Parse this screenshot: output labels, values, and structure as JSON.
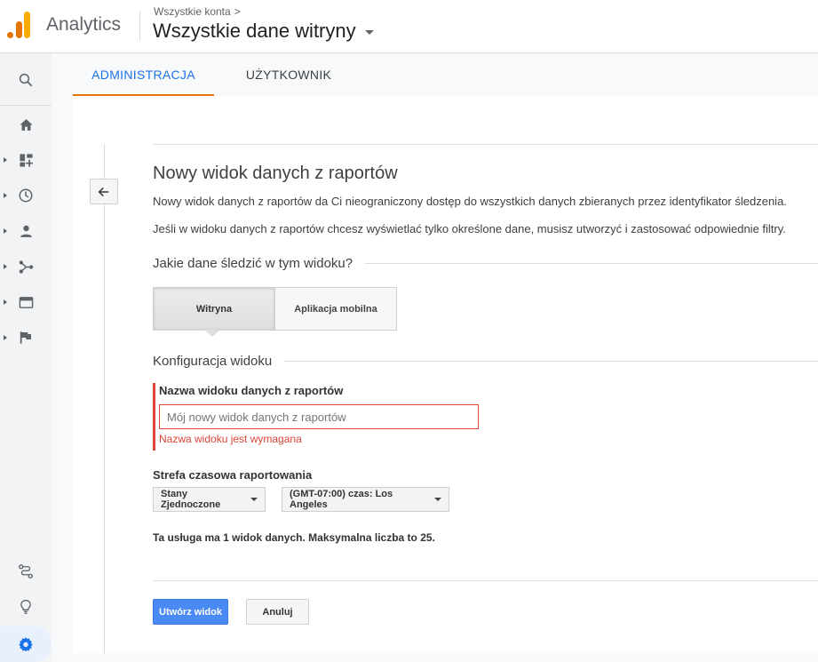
{
  "header": {
    "app_name": "Analytics",
    "breadcrumb": "Wszystkie konta",
    "breadcrumb_chevron": ">",
    "property_name": "Wszystkie dane witryny"
  },
  "sidebar": {
    "items": [
      {
        "icon": "search-icon"
      },
      {
        "icon": "home-icon"
      },
      {
        "icon": "customization-icon"
      },
      {
        "icon": "realtime-clock-icon"
      },
      {
        "icon": "audience-person-icon"
      },
      {
        "icon": "acquisition-icon"
      },
      {
        "icon": "behavior-icon"
      },
      {
        "icon": "conversions-flag-icon"
      },
      {
        "icon": "attribution-icon"
      },
      {
        "icon": "discover-lightbulb-icon"
      },
      {
        "icon": "admin-gear-icon"
      }
    ]
  },
  "tabs": [
    {
      "label": "ADMINISTRACJA",
      "active": true
    },
    {
      "label": "UŻYTKOWNIK",
      "active": false
    }
  ],
  "form": {
    "title": "Nowy widok danych z raportów",
    "desc1": "Nowy widok danych z raportów da Ci nieograniczony dostęp do wszystkich danych zbieranych przez identyfikator śledzenia.",
    "desc2": "Jeśli w widoku danych z raportów chcesz wyświetlać tylko określone dane, musisz utworzyć i zastosować odpowiednie filtry.",
    "track_question": "Jakie dane śledzić w tym widoku?",
    "toggle_web": "Witryna",
    "toggle_app": "Aplikacja mobilna",
    "config_title": "Konfiguracja widoku",
    "name_label": "Nazwa widoku danych z raportów",
    "name_value": "",
    "name_placeholder": "Mój nowy widok danych z raportów",
    "name_error": "Nazwa widoku jest wymagana",
    "tz_label": "Strefa czasowa raportowania",
    "tz_country": "Stany Zjednoczone",
    "tz_zone": "(GMT-07:00) czas: Los Angeles",
    "views_note": "Ta usługa ma 1 widok danych. Maksymalna liczba to 25.",
    "create_button": "Utwórz widok",
    "cancel_button": "Anuluj"
  },
  "colors": {
    "accent_blue": "#1a73e8",
    "tab_underline": "#e37400",
    "error_red": "#db4437",
    "primary_button": "#4a8af4",
    "logo_orange": "#f9ab00",
    "logo_dark_orange": "#e37400"
  }
}
